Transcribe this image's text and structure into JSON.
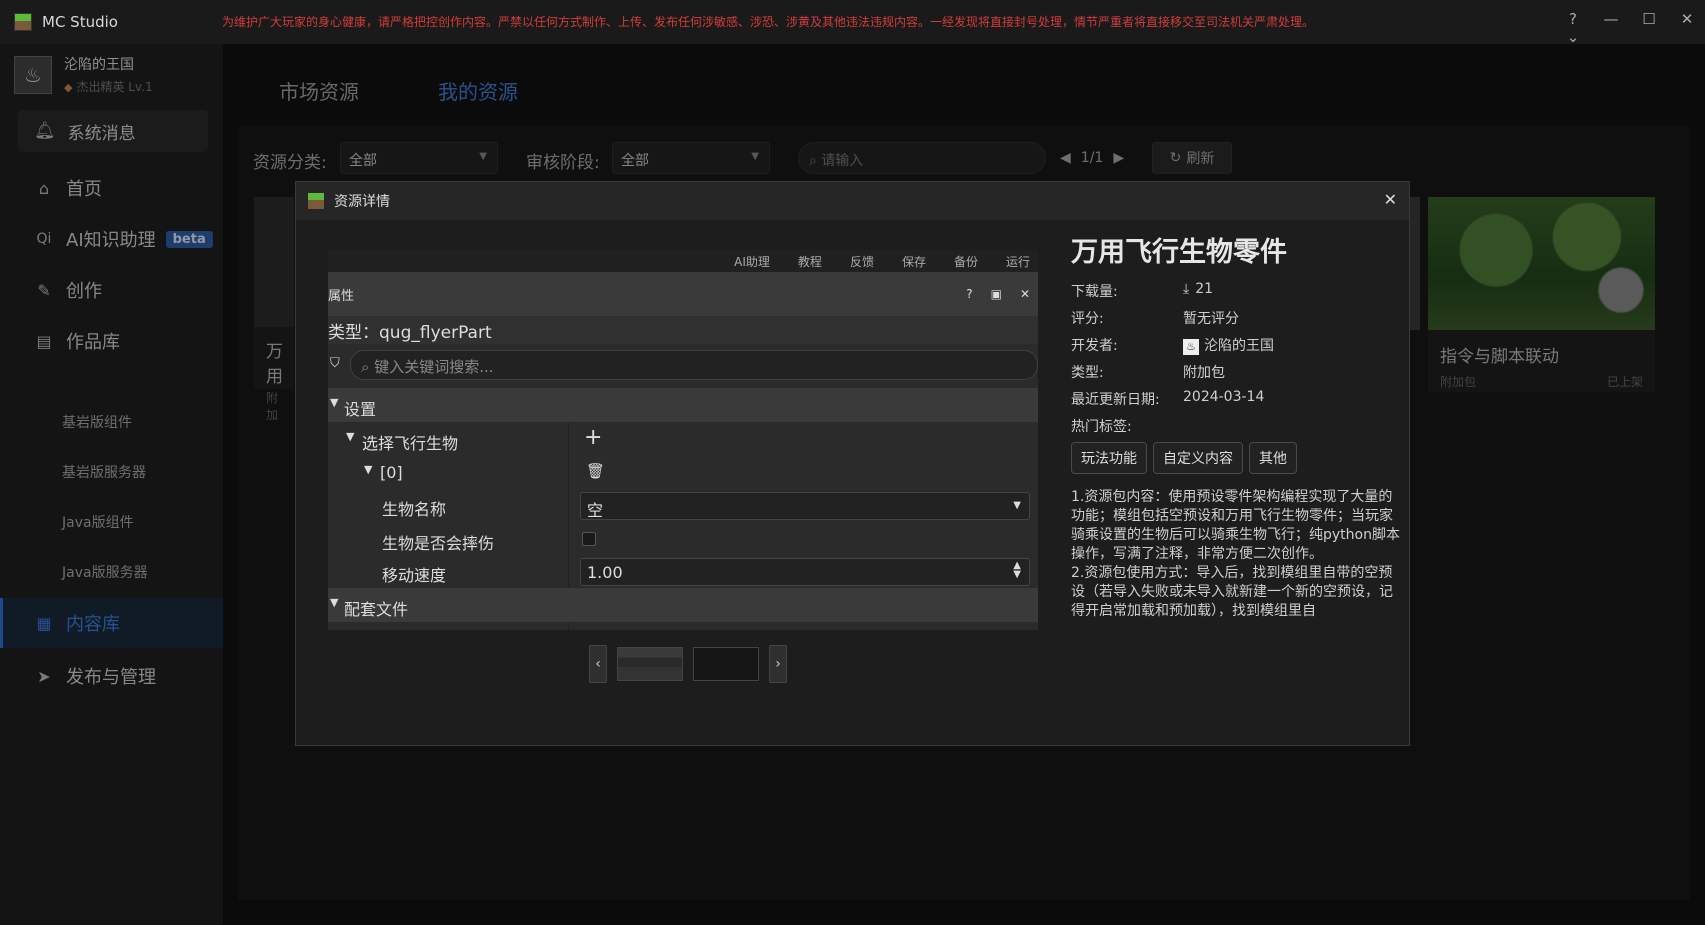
{
  "app": {
    "name": "MC Studio",
    "notice": "为维护广大玩家的身心健康，请严格把控创作内容。严禁以任何方式制作、上传、发布任何涉敏感、涉恐、涉黄及其他违法违规内容。一经发现将直接封号处理，情节严重者将直接移交至司法机关严肃处理。",
    "window_buttons": [
      "?⌄",
      "—",
      "☐",
      "✕"
    ]
  },
  "user": {
    "name": "沦陷的王国",
    "level": "杰出精英 Lv.1"
  },
  "sidebar": {
    "system_msg": "系统消息",
    "items": [
      {
        "label": "首页",
        "icon": "home-icon"
      },
      {
        "label": "AI知识助理",
        "icon": "ai-icon",
        "badge": "beta"
      },
      {
        "label": "创作",
        "icon": "pen-icon"
      },
      {
        "label": "作品库",
        "icon": "library-icon"
      }
    ],
    "sub_items": [
      "基岩版组件",
      "基岩版服务器",
      "Java版组件",
      "Java版服务器"
    ],
    "content_lib": "内容库",
    "publish": "发布与管理"
  },
  "tabs": {
    "market": "市场资源",
    "mine": "我的资源"
  },
  "filters": {
    "category_label": "资源分类:",
    "category_value": "全部",
    "stage_label": "审核阶段:",
    "stage_value": "全部",
    "search_placeholder": "请输入",
    "page": "1/1",
    "refresh": "刷新"
  },
  "cards": {
    "left_title": "万用",
    "left_sub": "附加",
    "right_title": "指令与脚本联动",
    "right_type": "附加包",
    "right_status": "已上架"
  },
  "modal": {
    "title": "资源详情",
    "preview": {
      "toolbar": [
        "AI助理",
        "教程",
        "反馈",
        "保存",
        "备份",
        "运行"
      ],
      "panel_title": "属性",
      "type_line": "类型：qug_flyerPart",
      "search_placeholder": "键入关键词搜索...",
      "section_settings": "设置",
      "select_flyer": "选择飞行生物",
      "index0": "[0]",
      "creature_name_label": "生物名称",
      "creature_name_value": "空",
      "fall_damage_label": "生物是否会摔伤",
      "move_speed_label": "移动速度",
      "move_speed_value": "1.00",
      "section_files": "配套文件"
    },
    "info": {
      "title": "万用飞行生物零件",
      "downloads_label": "下载量:",
      "downloads_value": "21",
      "rating_label": "评分:",
      "rating_value": "暂无评分",
      "developer_label": "开发者:",
      "developer_value": "沦陷的王国",
      "type_label": "类型:",
      "type_value": "附加包",
      "updated_label": "最近更新日期:",
      "updated_value": "2024-03-14",
      "tags_label": "热门标签:",
      "tags": [
        "玩法功能",
        "自定义内容",
        "其他"
      ],
      "description": "1.资源包内容：使用预设零件架构编程实现了大量的功能；模组包括空预设和万用飞行生物零件；当玩家骑乘设置的生物后可以骑乘生物飞行；纯python脚本操作，写满了注释，非常方便二次创作。\n2.资源包使用方式：导入后，找到模组里自带的空预设（若导入失败或未导入就新建一个新的空预设，记得开启常加载和预加载），找到模组里自"
    }
  }
}
